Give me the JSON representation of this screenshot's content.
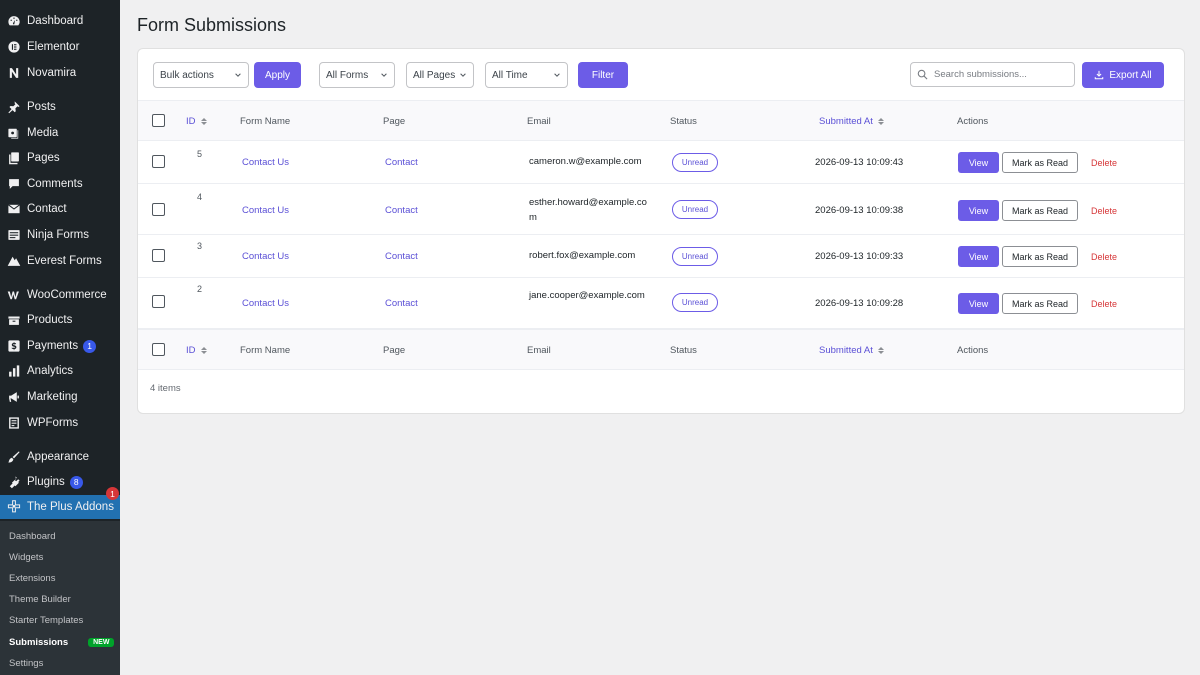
{
  "sidebar": {
    "items": [
      {
        "label": "Dashboard",
        "icon": "dashboard-icon"
      },
      {
        "label": "Elementor",
        "icon": "elementor-icon"
      },
      {
        "label": "Novamira",
        "icon": "novamira-icon"
      },
      {
        "label": "Posts",
        "icon": "pin-icon"
      },
      {
        "label": "Media",
        "icon": "media-icon"
      },
      {
        "label": "Pages",
        "icon": "pages-icon"
      },
      {
        "label": "Comments",
        "icon": "comments-icon"
      },
      {
        "label": "Contact",
        "icon": "mail-icon"
      },
      {
        "label": "Ninja Forms",
        "icon": "ninja-forms-icon"
      },
      {
        "label": "Everest Forms",
        "icon": "everest-forms-icon"
      },
      {
        "label": "WooCommerce",
        "icon": "woocommerce-icon"
      },
      {
        "label": "Products",
        "icon": "products-icon"
      },
      {
        "label": "Payments",
        "icon": "payments-icon",
        "badge": "1"
      },
      {
        "label": "Analytics",
        "icon": "analytics-icon"
      },
      {
        "label": "Marketing",
        "icon": "megaphone-icon"
      },
      {
        "label": "WPForms",
        "icon": "wpforms-icon"
      },
      {
        "label": "Appearance",
        "icon": "brush-icon"
      },
      {
        "label": "Plugins",
        "icon": "plugin-icon",
        "badge": "8"
      },
      {
        "label": "The Plus Addons",
        "icon": "plus-addons-icon",
        "badge": "1"
      }
    ],
    "submenu": [
      {
        "label": "Dashboard"
      },
      {
        "label": "Widgets"
      },
      {
        "label": "Extensions"
      },
      {
        "label": "Theme Builder"
      },
      {
        "label": "Starter Templates"
      },
      {
        "label": "Submissions",
        "tag": "NEW"
      },
      {
        "label": "Settings"
      }
    ]
  },
  "page": {
    "title": "Form Submissions"
  },
  "toolbar": {
    "bulk_actions": "Bulk actions",
    "apply": "Apply",
    "all_forms": "All Forms",
    "all_pages": "All Pages",
    "all_time": "All Time",
    "filter": "Filter",
    "search_placeholder": "Search submissions...",
    "export_all": "Export All"
  },
  "table": {
    "columns": {
      "id": "ID",
      "form_name": "Form Name",
      "page": "Page",
      "email": "Email",
      "status": "Status",
      "submitted_at": "Submitted At",
      "actions": "Actions"
    },
    "rows": [
      {
        "id": "5",
        "form_name": "Contact Us",
        "page": "Contact",
        "email": "cameron.w@example.com",
        "status": "Unread",
        "submitted_at": "2026-09-13 10:09:43"
      },
      {
        "id": "4",
        "form_name": "Contact Us",
        "page": "Contact",
        "email": "esther.howard@example.com",
        "status": "Unread",
        "submitted_at": "2026-09-13 10:09:38"
      },
      {
        "id": "3",
        "form_name": "Contact Us",
        "page": "Contact",
        "email": "robert.fox@example.com",
        "status": "Unread",
        "submitted_at": "2026-09-13 10:09:33"
      },
      {
        "id": "2",
        "form_name": "Contact Us",
        "page": "Contact",
        "email": "jane.cooper@example.com",
        "status": "Unread",
        "submitted_at": "2026-09-13 10:09:28"
      }
    ],
    "row_actions": {
      "view": "View",
      "mark_read": "Mark as Read",
      "delete": "Delete"
    },
    "footer_count": "4 items"
  },
  "colors": {
    "accent": "#6c5ce7",
    "sidebar_bg": "#1d2327",
    "active_menu": "#2271b1",
    "delete": "#d63638",
    "new_tag": "#00a32a"
  }
}
